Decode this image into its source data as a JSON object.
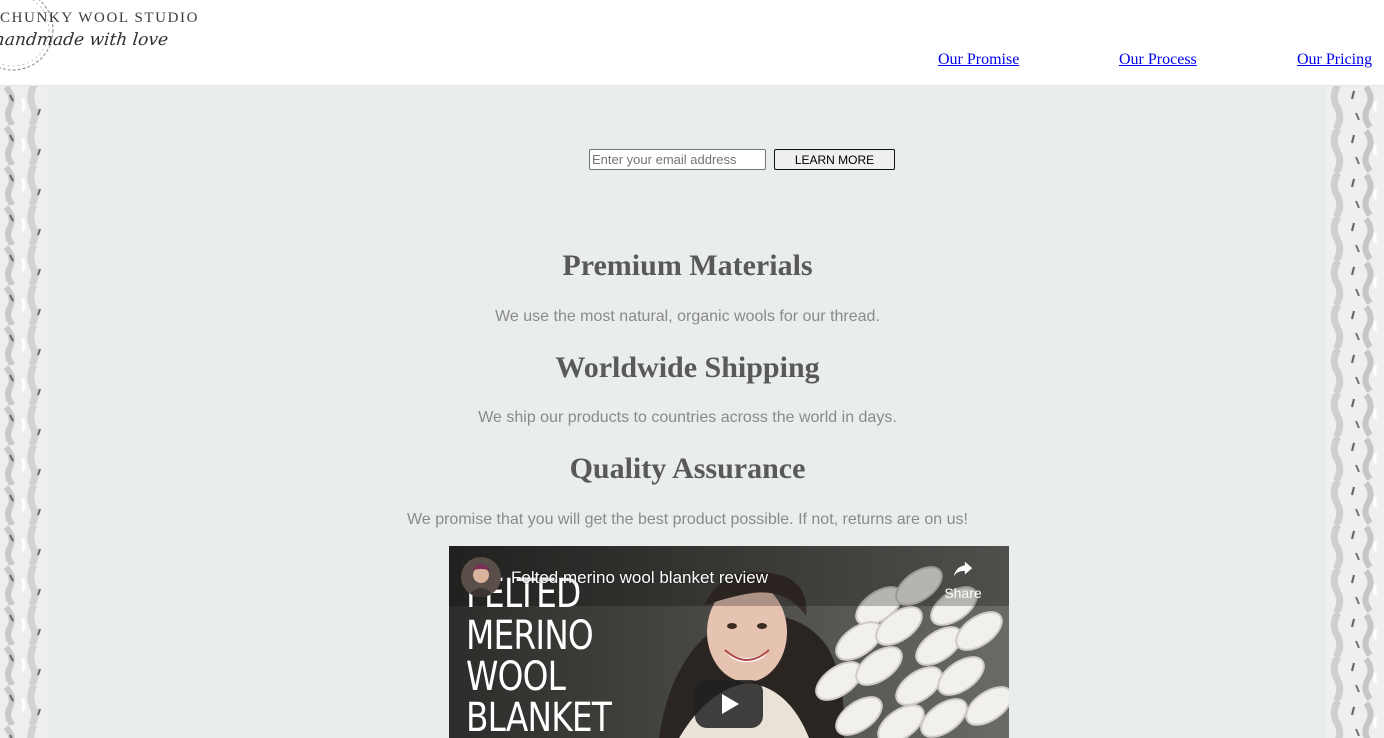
{
  "header": {
    "logo": {
      "brand": "CHUNKY WOOL STUDIO",
      "tagline": "handmade with love",
      "icon": "wreath-icon"
    },
    "nav": [
      {
        "label": "Our Promise"
      },
      {
        "label": "Our Process"
      },
      {
        "label": "Our Pricing"
      }
    ]
  },
  "signup": {
    "email_placeholder": "Enter your email address",
    "button_label": "LEARN MORE"
  },
  "features": [
    {
      "title": "Premium Materials",
      "text": "We use the most natural, organic wools for our thread."
    },
    {
      "title": "Worldwide Shipping",
      "text": "We ship our products to countries across the world in days."
    },
    {
      "title": "Quality Assurance",
      "text": "We promise that you will get the best product possible. If not, returns are on us!"
    }
  ],
  "video": {
    "title": "Felted merino wool blanket review",
    "share_label": "Share",
    "overlay_lines": [
      "FELTED",
      "MERINO",
      "WOOL",
      "BLANKET"
    ],
    "icons": {
      "share": "share-icon",
      "play": "play-icon",
      "avatar": "channel-avatar"
    }
  },
  "colors": {
    "main_bg": "#eaeded",
    "heading": "#595959",
    "body_text": "#8a8a8a",
    "link": "#0000ee"
  }
}
